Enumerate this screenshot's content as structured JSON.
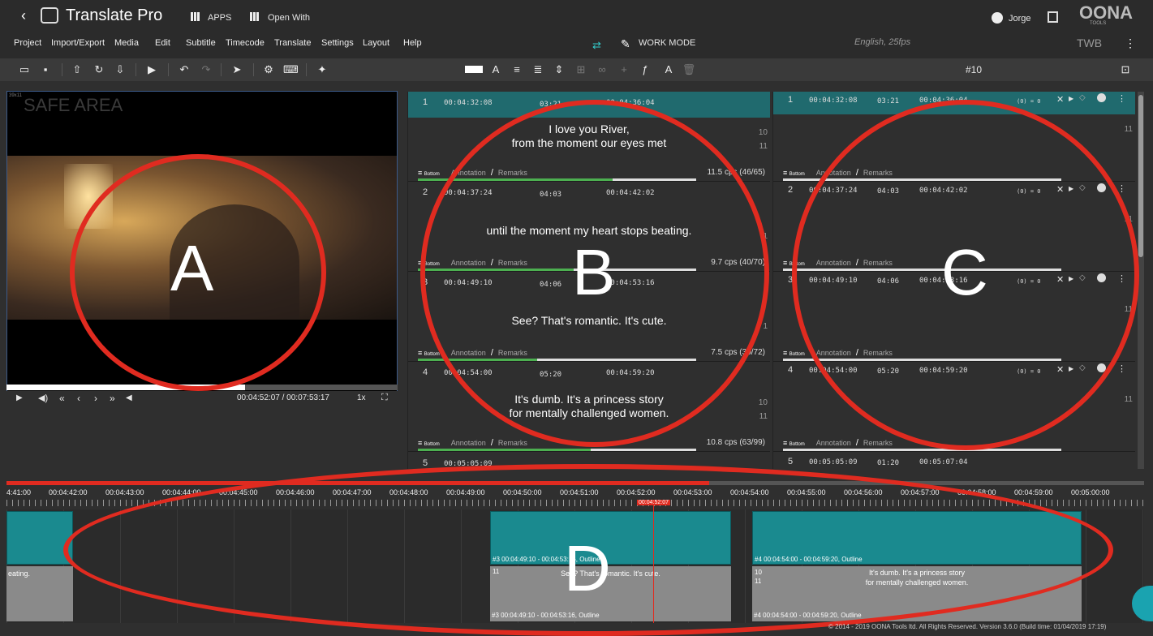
{
  "app": {
    "title": "Translate Pro",
    "apps": "APPS",
    "open_with": "Open With",
    "user": "Jorge",
    "logo": "OONA",
    "logo_sub": "TOOLS"
  },
  "menu": [
    "Project",
    "Import/Export",
    "Media",
    "Edit",
    "Subtitle",
    "Timecode",
    "Translate",
    "Settings",
    "Layout",
    "Help"
  ],
  "mode": {
    "label": "WORK MODE",
    "language": "English, 25fps",
    "twb": "TWB"
  },
  "toolbar": {
    "counter": "#10"
  },
  "video": {
    "safe_area": "SAFE AREA",
    "corner": "39x11",
    "time": "00:04:52:07 / 00:07:53:17",
    "speed": "1x",
    "progress": 0.61
  },
  "cues_source": [
    {
      "num": "1",
      "in": "00:04:32:08",
      "dur": "03:21",
      "out": "00:04:36:04",
      "lines": [
        "I love you River,",
        "from the moment our eyes met"
      ],
      "ln": [
        "10",
        "11"
      ],
      "cps": "11.5 cps (46/65)",
      "fill": 0.7
    },
    {
      "num": "2",
      "in": "00:04:37:24",
      "dur": "04:03",
      "out": "00:04:42:02",
      "lines": [
        "until the moment my heart stops beating."
      ],
      "ln": [
        "1"
      ],
      "cps": "9.7 cps (40/70)",
      "fill": 0.56
    },
    {
      "num": "3",
      "in": "00:04:49:10",
      "dur": "04:06",
      "out": "00:04:53:16",
      "lines": [
        "See? That's romantic. It's cute."
      ],
      "ln": [
        "1"
      ],
      "cps": "7.5 cps (30/72)",
      "fill": 0.43
    },
    {
      "num": "4",
      "in": "00:04:54:00",
      "dur": "05:20",
      "out": "00:04:59:20",
      "lines": [
        "It's dumb. It's a princess story",
        "for mentally challenged women."
      ],
      "ln": [
        "10",
        "11"
      ],
      "cps": "10.8 cps (63/99)",
      "fill": 0.62
    }
  ],
  "cue5": {
    "num": "5",
    "in": "00:05:05:09",
    "dur": "01:20",
    "out": "00:05:07:04"
  },
  "cues_target": [
    {
      "num": "1",
      "in": "00:04:32:08",
      "dur": "03:21",
      "out": "00:04:36:04",
      "ln": "11"
    },
    {
      "num": "2",
      "in": "00:04:37:24",
      "dur": "04:03",
      "out": "00:04:42:02",
      "ln": "11"
    },
    {
      "num": "3",
      "in": "00:04:49:10",
      "dur": "04:06",
      "out": "00:04:53:16",
      "ln": "11"
    },
    {
      "num": "4",
      "in": "00:04:54:00",
      "dur": "05:20",
      "out": "00:04:59:20",
      "ln": "11"
    }
  ],
  "labels": {
    "bottom": "Bottom",
    "annotation": "Annotation",
    "remarks": "Remarks",
    "slash": "/",
    "zero": "(0) = 0"
  },
  "timeline": {
    "ticks": [
      "4:41:00",
      "00:04:42:00",
      "00:04:43:00",
      "00:04:44:00",
      "00:04:45:00",
      "00:04:46:00",
      "00:04:47:00",
      "00:04:48:00",
      "00:04:49:00",
      "00:04:50:00",
      "00:04:51:00",
      "00:04:52:00",
      "00:04:53:00",
      "00:04:54:00",
      "00:04:55:00",
      "00:04:56:00",
      "00:04:57:00",
      "00:04:58:00",
      "00:04:59:00",
      "00:05:00:00"
    ],
    "playhead": "00:04:52:07",
    "block3_top": "#3 00:04:49:10 - 00:04:53:16, Outline",
    "block3_bot": "#3 00:04:49:10 - 00:04:53:16, Outline",
    "block3_text": "See? That's romantic. It's cute.",
    "block4_top": "#4 00:04:54:00 - 00:04:59:20, Outline",
    "block4_bot": "#4 00:04:54:00 - 00:04:59:20, Outline",
    "block4_text": [
      "It's dumb. It's a princess story",
      "for mentally challenged women."
    ],
    "left_text": "eating."
  },
  "annot": {
    "a": "A",
    "b": "B",
    "c": "C",
    "d": "D"
  },
  "footer": "© 2014 - 2019 OONA Tools ltd. All Rights Reserved. Version 3.6.0 (Build time: 01/04/2019 17:19)"
}
